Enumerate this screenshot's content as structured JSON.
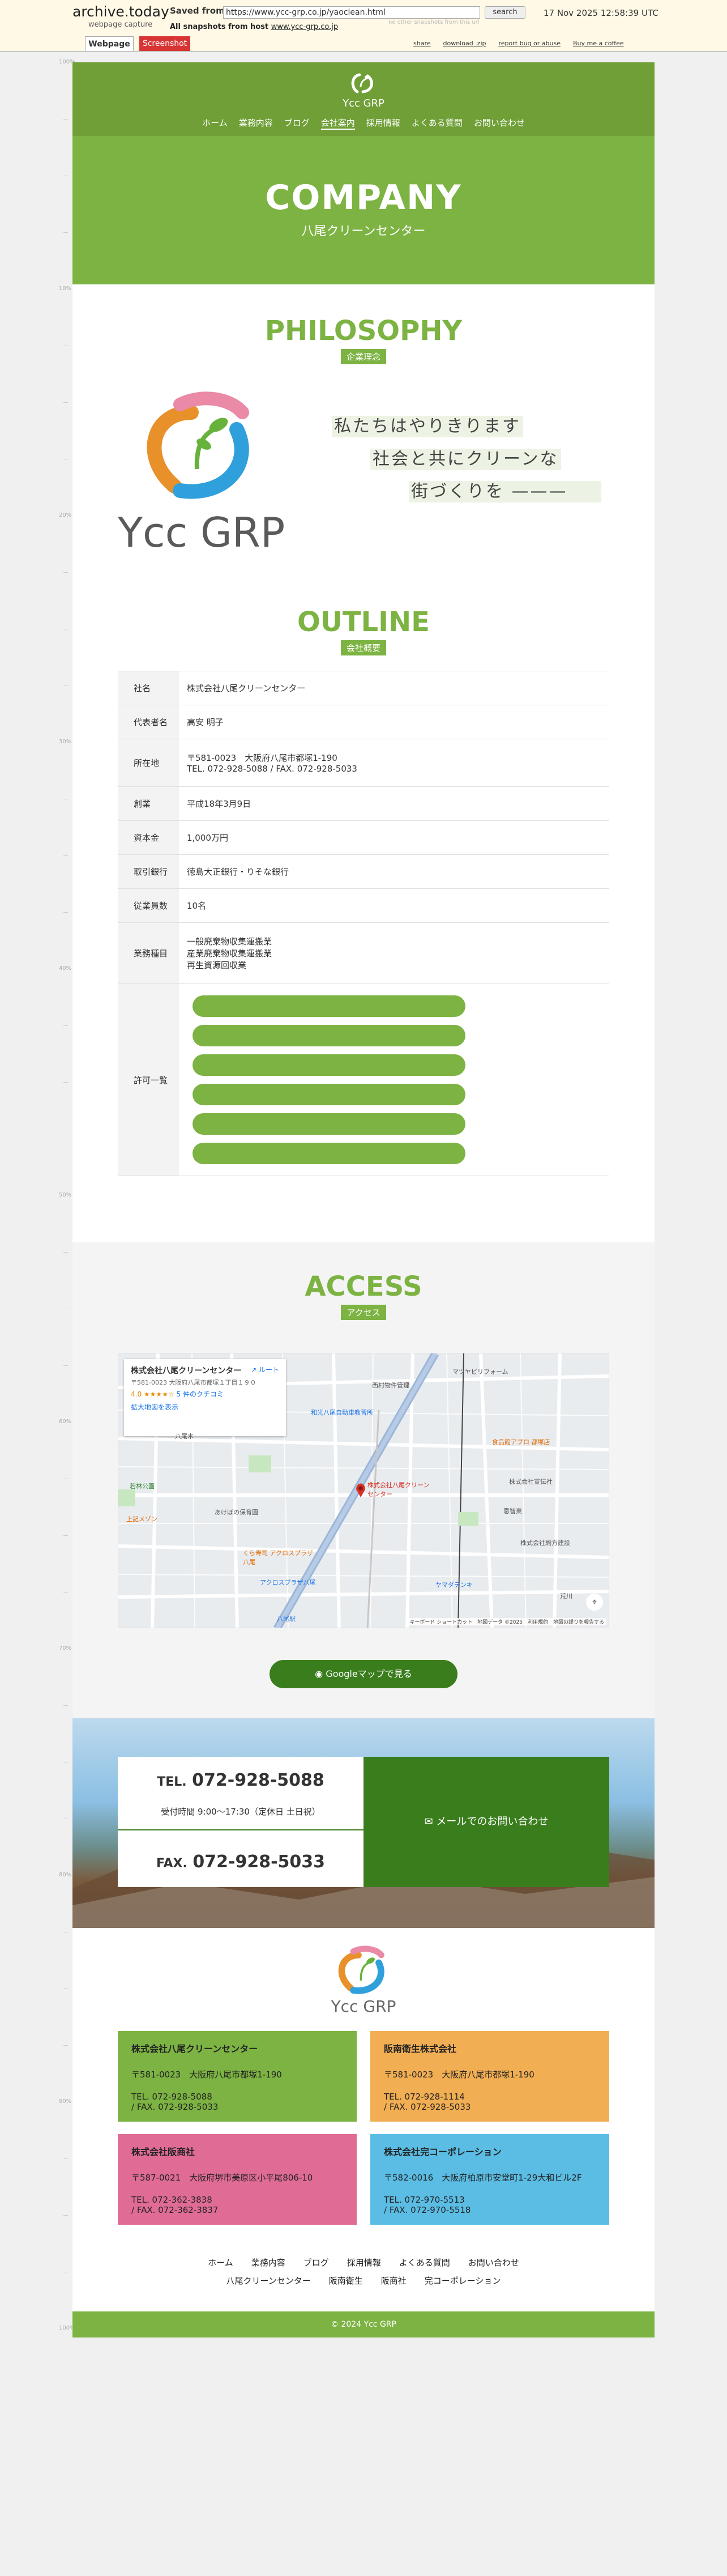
{
  "archive": {
    "logo": "archive.today",
    "logo_sub": "webpage capture",
    "saved_from_label": "Saved from",
    "url": "https://www.ycc-grp.co.jp/yaoclean.html",
    "search_label": "search",
    "date": "17 Nov 2025 12:58:39 UTC",
    "no_other": "no other snapshots from this url",
    "all_snapshots_label": "All snapshots from host",
    "host": "www.ycc-grp.co.jp",
    "tabs": [
      "Webpage",
      "Screenshot"
    ],
    "actions": [
      "share",
      "download .zip",
      "report bug or abuse",
      "Buy me a coffee"
    ]
  },
  "ruler": [
    "100%",
    "10%",
    "20%",
    "30%",
    "40%",
    "50%",
    "60%",
    "70%",
    "80%",
    "90%",
    "100%"
  ],
  "header": {
    "brand": "Ycc GRP",
    "nav": [
      "ホーム",
      "業務内容",
      "ブログ",
      "会社案内",
      "採用情報",
      "よくある質問",
      "お問い合わせ"
    ]
  },
  "hero": {
    "title": "COMPANY",
    "subtitle": "八尾クリーンセンター"
  },
  "philosophy": {
    "title": "PHILOSOPHY",
    "badge": "企業理念",
    "logo_text": "Ycc GRP",
    "lines": [
      "私たちはやりきります",
      "社会と共にクリーンな",
      "街づくりを ———"
    ]
  },
  "outline": {
    "title": "OUTLINE",
    "badge": "会社概要",
    "rows": [
      {
        "k": "社名",
        "v": [
          "株式会社八尾クリーンセンター"
        ]
      },
      {
        "k": "代表者名",
        "v": [
          "高安 明子"
        ]
      },
      {
        "k": "所在地",
        "v": [
          "〒581-0023　大阪府八尾市都塚1-190",
          "TEL. 072-928-5088 / FAX. 072-928-5033"
        ]
      },
      {
        "k": "創業",
        "v": [
          "平成18年3月9日"
        ]
      },
      {
        "k": "資本金",
        "v": [
          "1,000万円"
        ]
      },
      {
        "k": "取引銀行",
        "v": [
          "徳島大正銀行・りそな銀行"
        ]
      },
      {
        "k": "従業員数",
        "v": [
          "10名"
        ]
      },
      {
        "k": "業務種目",
        "v": [
          "一般廃棄物収集運搬業",
          "産業廃棄物収集運搬業",
          "再生資源回収業"
        ]
      }
    ],
    "license_label": "許可一覧"
  },
  "access": {
    "title": "ACCESS",
    "badge": "アクセス",
    "map_card": {
      "name": "株式会社八尾クリーンセンター",
      "address": "〒581-0023 大阪府八尾市都塚１丁目１９０",
      "rating": "4.0 ★★★★☆",
      "reviews": "5 件のクチコミ",
      "larger": "拡大地図を表示",
      "route": "ルート"
    },
    "map_labels": [
      "西村物件管理",
      "マツヤビリフォーム",
      "食品館アプロ 都塚店",
      "和光八尾自動車教習所",
      "八尾木",
      "株式会社八尾クリーンセンター",
      "若林公園",
      "あけぼの保育園",
      "くら寿司 アクロスプラザ八尾",
      "アクロスプラザ八尾",
      "上記メゾン",
      "ヤマダデンキ",
      "株式会社宣伝社",
      "株式会社駒方建設",
      "八尾駅",
      "恩智東",
      "荒川"
    ],
    "map_footer": "キーボード ショートカット　地図データ ©2025　利用規約　地図の誤りを報告する",
    "button": "Googleマップで見る"
  },
  "contact": {
    "tel_label": "TEL.",
    "tel": "072-928-5088",
    "hours": "受付時間 9:00〜17:30（定休日 土日祝）",
    "fax_label": "FAX.",
    "fax": "072-928-5033",
    "mail": "メールでのお問い合わせ"
  },
  "footer": {
    "logo_text": "Ycc GRP",
    "companies": [
      {
        "name": "株式会社八尾クリーンセンター",
        "address": "〒581-0023　大阪府八尾市都塚1-190",
        "tel": "TEL. 072-928-5088",
        "fax": "/ FAX. 072-928-5033",
        "color": "#7cb342"
      },
      {
        "name": "阪南衛生株式会社",
        "address": "〒581-0023　大阪府八尾市都塚1-190",
        "tel": "TEL. 072-928-1114",
        "fax": "/ FAX. 072-928-5033",
        "color": "#f2ae52"
      },
      {
        "name": "株式会社阪商社",
        "address": "〒587-0021　大阪府堺市美原区小平尾806-10",
        "tel": "TEL. 072-362-3838",
        "fax": "/ FAX. 072-362-3837",
        "color": "#e06c96"
      },
      {
        "name": "株式会社完コーポレーション",
        "address": "〒582-0016　大阪府柏原市安堂町1-29大和ビル2F",
        "tel": "TEL. 072-970-5513",
        "fax": "/ FAX. 072-970-5518",
        "color": "#5bbde4"
      }
    ],
    "nav1": [
      "ホーム",
      "業務内容",
      "ブログ",
      "採用情報",
      "よくある質問",
      "お問い合わせ"
    ],
    "nav2": [
      "八尾クリーンセンター",
      "阪南衛生",
      "阪商社",
      "完コーポレーション"
    ],
    "copyright": "© 2024 Ycc GRP"
  }
}
